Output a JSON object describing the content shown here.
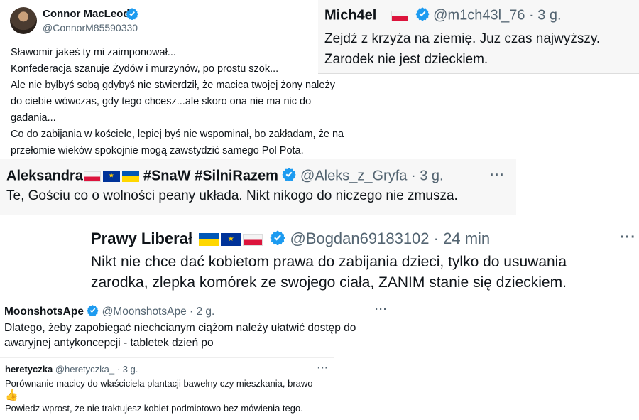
{
  "tweets": [
    {
      "display_name": "Connor MacLeod",
      "handle": "@ConnorM85590330",
      "body_lines": [
        "Sławomir jakeś ty mi zaimponował...",
        "Konfederacja szanuje Żydów i murzynów, po prostu szok...",
        "Ale nie byłbyś sobą gdybyś nie stwierdził, że macica twojej żony należy",
        "do ciebie wówczas, gdy tego chcesz...ale skoro ona nie ma nic do",
        "gadania...",
        "Co do zabijania w kościele, lepiej byś nie wspominał, bo zakładam, że na",
        "przełomie wieków spokojnie mogą zawstydzić samego Pol Pota."
      ]
    },
    {
      "display_name": "Mich4el_",
      "handle": "@m1ch43l_76",
      "separator": "·",
      "time": "3 g.",
      "body_lines": [
        "Zejdź z krzyża na ziemię. Juz czas najwyższy.",
        "Zarodek nie jest dzieckiem."
      ]
    },
    {
      "display_name": "Aleksandra",
      "hashtags": "#SnaW #SilniRazem",
      "handle": "@Aleks_z_Gryfa",
      "separator": "·",
      "time": "3 g.",
      "more": "···",
      "body": "Te, Gościu co o wolności peany układa. Nikt nikogo do niczego nie zmusza."
    },
    {
      "display_name": "Prawy Liberał",
      "handle": "@Bogdan69183102",
      "separator": "·",
      "time": "24 min",
      "more": "···",
      "body_lines": [
        "Nikt nie chce dać kobietom prawa do zabijania dzieci, tylko do usuwania",
        "zarodka, zlepka komórek ze swojego ciała, ZANIM stanie się dzieckiem."
      ]
    },
    {
      "display_name": "MoonshotsApe",
      "handle": "@MoonshotsApe",
      "separator": "·",
      "time": "2 g.",
      "more": "···",
      "body_lines": [
        "Dlatego, żeby zapobiegać niechcianym ciążom należy ułatwić dostęp do",
        "awaryjnej antykoncepcji - tabletek dzień po"
      ]
    },
    {
      "display_name": "heretyczka",
      "handle": "@heretyczka_",
      "separator": "·",
      "time": "3 g.",
      "more": "···",
      "body_lines": [
        "Porównanie macicy do właściciela plantacji bawełny czy mieszkania, brawo",
        "👍",
        "Powiedz wprost, że nie traktujesz kobiet podmiotowo bez mówienia tego."
      ]
    }
  ],
  "icons": {
    "verified": "verified-badge-icon",
    "flag_pl": "poland-flag-icon",
    "flag_eu": "eu-flag-icon",
    "flag_ua": "ukraine-flag-icon",
    "eu_stars": "★"
  },
  "colors": {
    "verified_blue": "#1d9bf0",
    "handle_gray": "#536471",
    "text": "#0f1419"
  }
}
